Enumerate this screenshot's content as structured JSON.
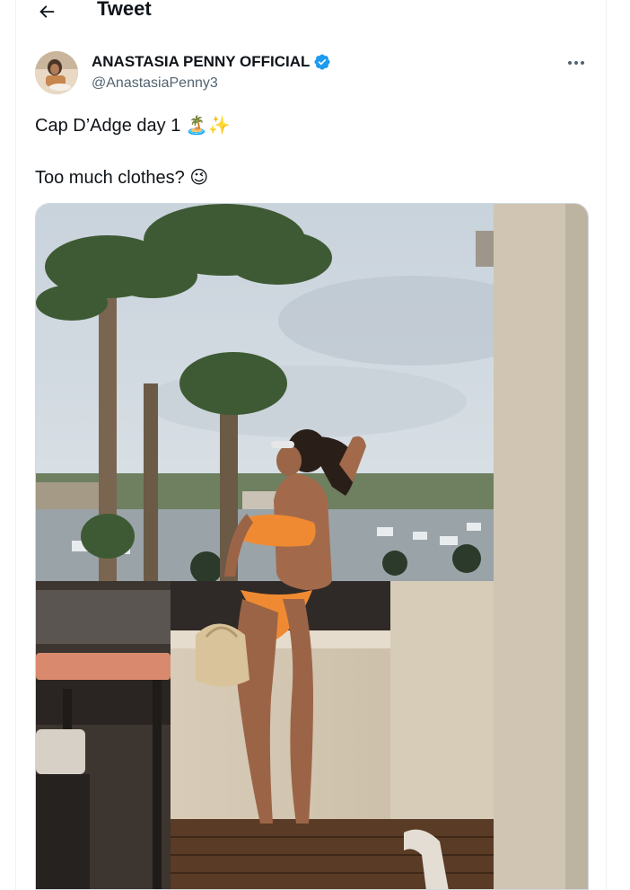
{
  "header": {
    "title": "Tweet",
    "back_icon": "arrow-left-icon"
  },
  "tweet": {
    "author": {
      "display_name": "ANASTASIA PENNY OFFICIAL",
      "handle": "@AnastasiaPenny3",
      "verified": true,
      "verified_color": "#1d9bf0"
    },
    "text_line_1": "Cap D’Adge day 1 🏝️✨",
    "text_line_2": "Too much clothes? 😉",
    "more_icon": "more-dots-icon"
  },
  "colors": {
    "text": "#0f1419",
    "secondary": "#536471",
    "border": "#eff3f4",
    "accent": "#1d9bf0"
  }
}
